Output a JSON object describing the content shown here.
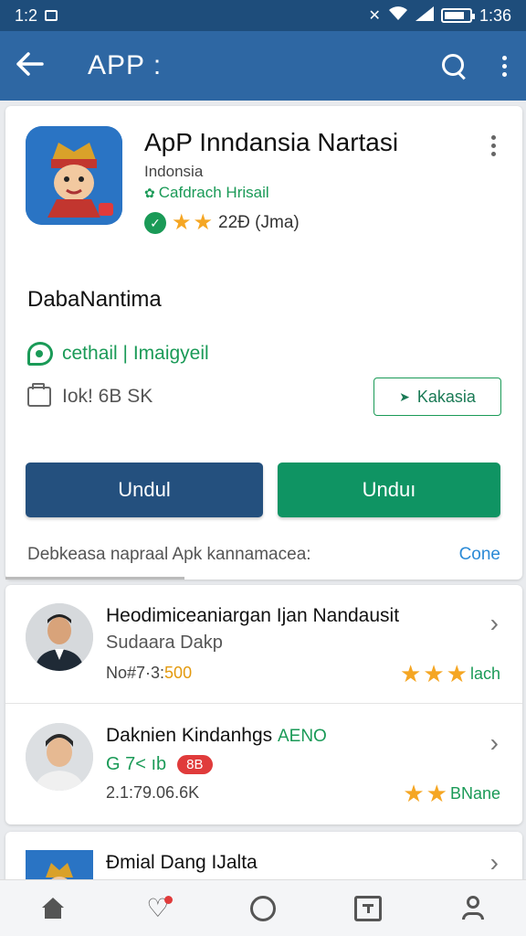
{
  "status_bar": {
    "time_left": "1:2",
    "time_right": "1:36",
    "battery_level": 0.8
  },
  "app_bar": {
    "title": "APP :",
    "back_icon": "back-arrow-icon",
    "search_icon": "search-icon",
    "menu_icon": "more-vert-icon"
  },
  "app": {
    "name": "ApP Inndansia Nartasi",
    "developer": "Indonsia",
    "category": "Cafdrach Hrisail",
    "rating_text": "22Ð (Jma)",
    "rating_stars": 2
  },
  "section": {
    "title": "DabaNantima",
    "detail_text": "cethail | Imaigyeil",
    "size_text": "Iok! 6B SK",
    "secondary_button": "Kakasia",
    "primary_left": "Undul",
    "primary_right": "Unduı",
    "footer_note": "Debkeasa napraal  Apk kannamacea:",
    "footer_link": "Cone"
  },
  "list": [
    {
      "title": "Heodimiceaniargan Ijan Nandausit",
      "subtitle": "Sudaara Dakp",
      "meta_prefix": "No#7·3:",
      "meta_accent": "500",
      "rating_label": "lach",
      "stars": 3
    },
    {
      "title": "Daknien Kindanhgs",
      "title_tag": "AENO",
      "tag_text": "G 7< ıb",
      "badge": "8B",
      "meta": "2.1:79.06.6K",
      "rating_label": "BNane",
      "stars": 2
    },
    {
      "title": "Đmial Dang IJalta"
    }
  ],
  "colors": {
    "app_bar": "#2e67a3",
    "status_bar": "#1e4d7b",
    "primary_blue": "#24507e",
    "primary_green": "#0f9463",
    "accent_green": "#1a9a57",
    "star": "#f5a623"
  },
  "nav": [
    "home-icon",
    "heart-icon",
    "circle-icon",
    "square-icon",
    "person-icon"
  ]
}
